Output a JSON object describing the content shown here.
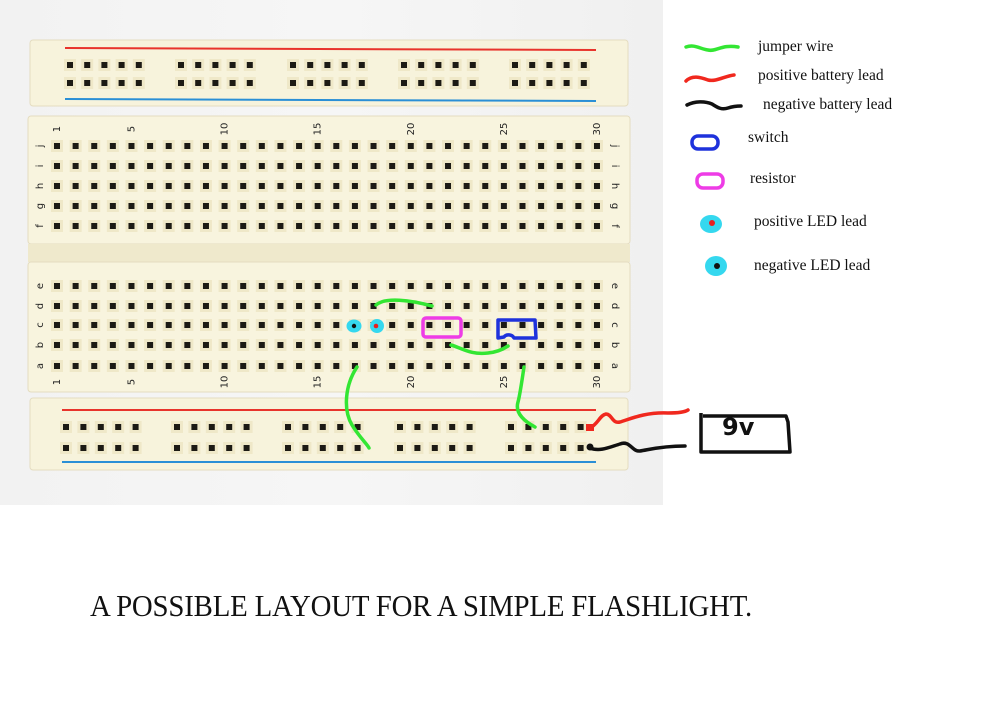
{
  "caption": "A POSSIBLE LAYOUT FOR A SIMPLE FLASHLIGHT.",
  "battery": {
    "label": "9V",
    "display_text": "9v"
  },
  "colors": {
    "jumper_wire": "#33e633",
    "positive_lead": "#f0281e",
    "negative_lead": "#111111",
    "switch": "#1e32dc",
    "resistor": "#ee3ce6",
    "led": "#35d8ef",
    "rail_red": "#e8342c",
    "rail_blue": "#2a8fd6",
    "board": "#f7f3dc"
  },
  "legend": [
    {
      "key": "jumper-wire",
      "label": "jumper wire",
      "icon": "green-squiggle"
    },
    {
      "key": "positive-battery-lead",
      "label": "positive battery lead",
      "icon": "red-squiggle"
    },
    {
      "key": "negative-battery-lead",
      "label": "negative battery lead",
      "icon": "black-squiggle"
    },
    {
      "key": "switch",
      "label": "switch",
      "icon": "blue-rounded-rect"
    },
    {
      "key": "resistor",
      "label": "resistor",
      "icon": "magenta-rounded-rect"
    },
    {
      "key": "positive-led-lead",
      "label": "positive LED lead",
      "icon": "cyan-blob-red-dot"
    },
    {
      "key": "negative-led-lead",
      "label": "negative LED lead",
      "icon": "cyan-blob-black-dot"
    }
  ],
  "breadboard": {
    "columns": 30,
    "column_labels_top": [
      "1",
      "5",
      "10",
      "15",
      "20",
      "25",
      "30"
    ],
    "column_labels_bottom": [
      "1",
      "5",
      "10",
      "15",
      "20",
      "25",
      "30"
    ],
    "upper_rows": [
      "j",
      "i",
      "h",
      "g",
      "f"
    ],
    "lower_rows": [
      "e",
      "d",
      "c",
      "b",
      "a"
    ],
    "rail_groups": 5,
    "holes_per_group": 5
  },
  "components": {
    "negative_led_lead": {
      "row": "c",
      "column": 17
    },
    "positive_led_lead": {
      "row": "c",
      "column": 18
    },
    "resistor": {
      "row": "c",
      "columns": [
        21,
        22
      ]
    },
    "switch": {
      "row": "c",
      "columns": [
        25,
        26
      ]
    },
    "jumpers": [
      {
        "from": "d18",
        "to": "d21"
      },
      {
        "from": "b22",
        "to": "b25"
      },
      {
        "from": "a17",
        "to": "bottom negative rail"
      },
      {
        "from": "a26",
        "to": "bottom positive rail"
      }
    ]
  }
}
